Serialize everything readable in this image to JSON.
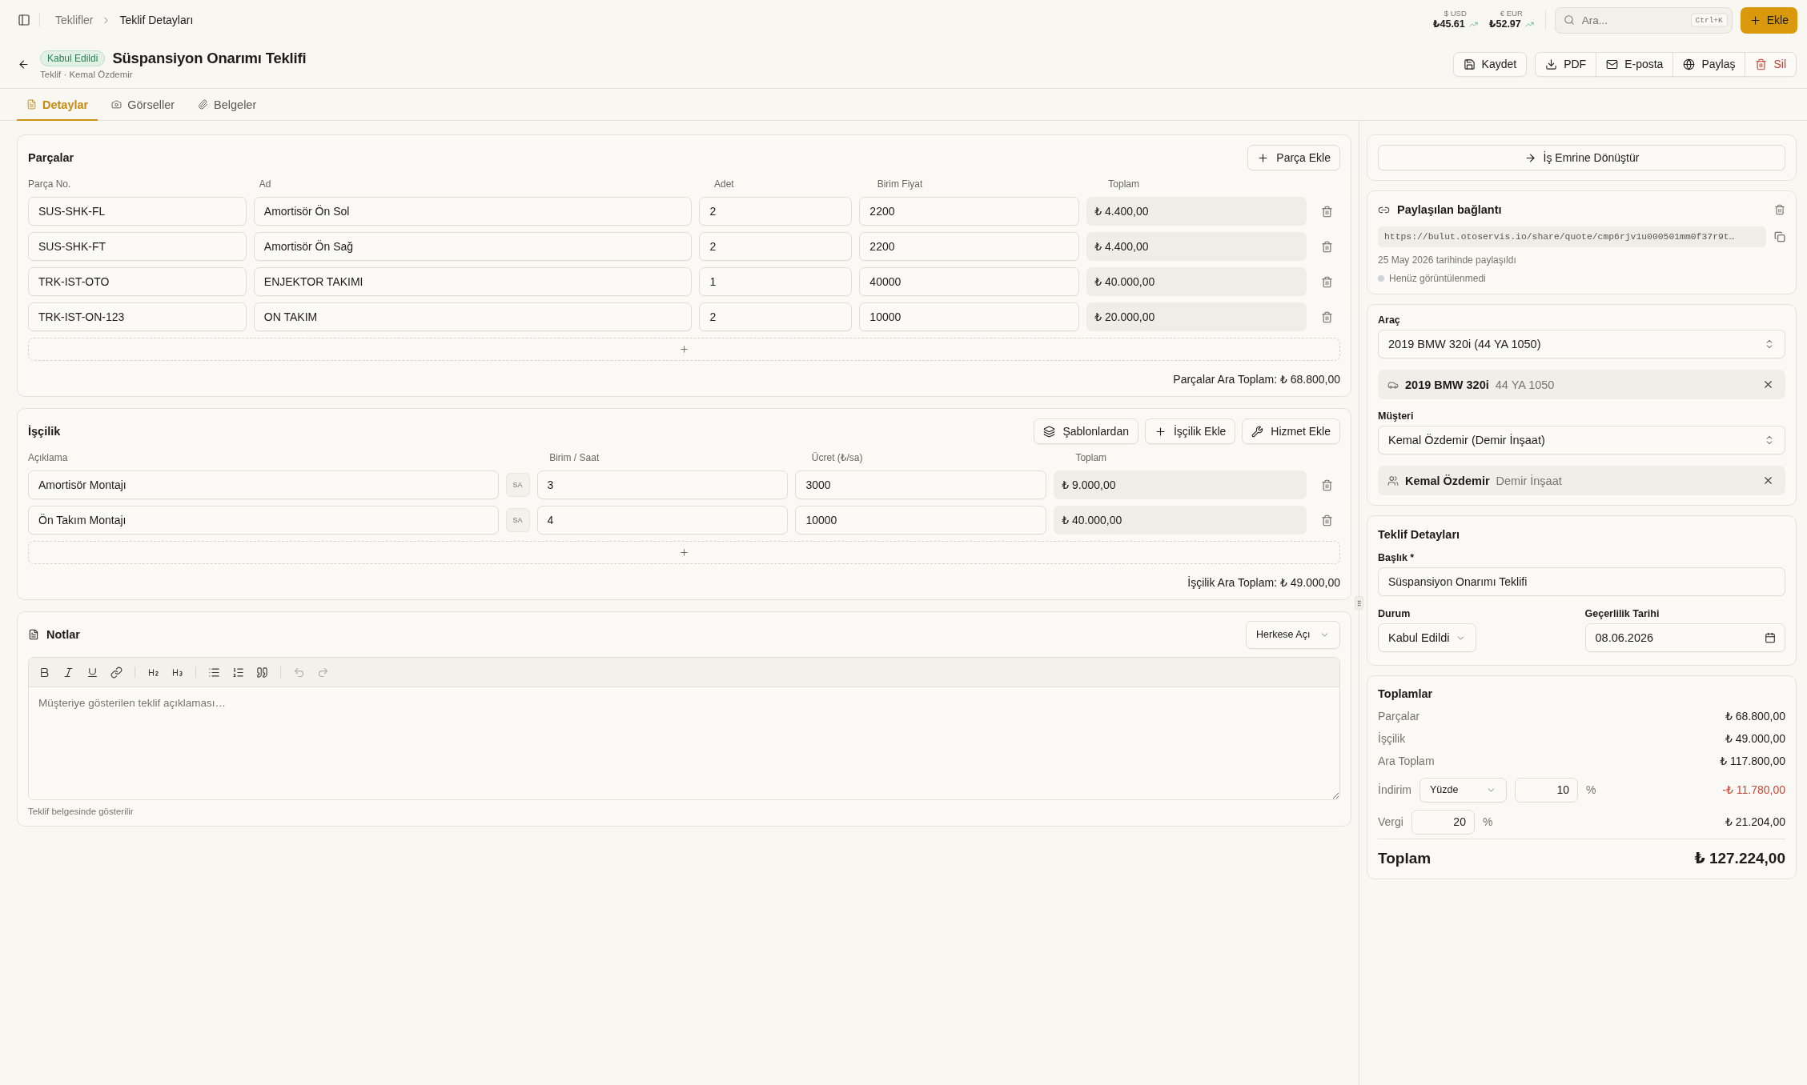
{
  "topbar": {
    "breadcrumb": {
      "parent": "Teklifler",
      "current": "Teklif Detayları"
    },
    "rates": [
      {
        "label": "$ USD",
        "value": "₺45.61"
      },
      {
        "label": "€ EUR",
        "value": "₺52.97"
      }
    ],
    "search": {
      "placeholder": "Ara...",
      "shortcut": "Ctrl+K"
    },
    "add_button": "Ekle"
  },
  "header": {
    "status": "Kabul Edildi",
    "title": "Süspansiyon Onarımı Teklifi",
    "subtitle": "Teklif · Kemal Özdemir",
    "actions": [
      {
        "kind": "save",
        "label": "Kaydet"
      },
      {
        "kind": "pdf",
        "label": "PDF"
      },
      {
        "kind": "email",
        "label": "E-posta"
      },
      {
        "kind": "share",
        "label": "Paylaş"
      },
      {
        "kind": "delete",
        "label": "Sil"
      }
    ]
  },
  "tabs": [
    {
      "kind": "details",
      "label": "Detaylar",
      "selected": true
    },
    {
      "kind": "images",
      "label": "Görseller",
      "selected": false
    },
    {
      "kind": "documents",
      "label": "Belgeler",
      "selected": false
    }
  ],
  "parts": {
    "title": "Parçalar",
    "add_button": "Parça Ekle",
    "columns": [
      "Parça No.",
      "Ad",
      "Adet",
      "Birim Fiyat",
      "Toplam"
    ],
    "rows": [
      {
        "part_no": "SUS-SHK-FL",
        "name": "Amortisör Ön Sol",
        "qty": "2",
        "unit_price": "2200",
        "total": "₺ 4.400,00"
      },
      {
        "part_no": "SUS-SHK-FT",
        "name": "Amortisör Ön Sağ",
        "qty": "2",
        "unit_price": "2200",
        "total": "₺ 4.400,00"
      },
      {
        "part_no": "TRK-IST-OTO",
        "name": "ENJEKTOR TAKIMI",
        "qty": "1",
        "unit_price": "40000",
        "total": "₺ 40.000,00"
      },
      {
        "part_no": "TRK-IST-ON-123",
        "name": "ON TAKIM",
        "qty": "2",
        "unit_price": "10000",
        "total": "₺ 20.000,00"
      }
    ],
    "subtotal": "Parçalar Ara Toplam: ₺ 68.800,00"
  },
  "labor": {
    "title": "İşçilik",
    "buttons": [
      {
        "kind": "templates",
        "label": "Şablonlardan"
      },
      {
        "kind": "add",
        "label": "İşçilik Ekle"
      },
      {
        "kind": "service",
        "label": "Hizmet Ekle"
      }
    ],
    "columns": [
      "Açıklama",
      "Birim / Saat",
      "Ücret (₺/sa)",
      "Toplam"
    ],
    "rows": [
      {
        "description": "Amortisör Montajı",
        "unit": "SA",
        "hours": "3",
        "rate": "3000",
        "total": "₺ 9.000,00"
      },
      {
        "description": "Ön Takım Montajı",
        "unit": "SA",
        "hours": "4",
        "rate": "10000",
        "total": "₺ 40.000,00"
      }
    ],
    "subtotal": "İşçilik Ara Toplam: ₺ 49.000,00"
  },
  "notes": {
    "title": "Notlar",
    "visibility": "Herkese Açı",
    "undo_disabled": true,
    "redo_disabled": true,
    "placeholder": "Müşteriye gösterilen teklif açıklaması…",
    "hint": "Teklif belgesinde gösterilir"
  },
  "convert_button": "İş Emrine Dönüştür",
  "shared_link": {
    "title": "Paylaşılan bağlantı",
    "url": "https://bulut.otoservis.io/share/quote/cmp6rjv1u000501mm0f37r9t…",
    "shared_date": "25 May 2026 tarihinde paylaşıldı",
    "views": "Henüz görüntülenmedi"
  },
  "vehicle": {
    "label": "Araç",
    "select_value": "2019 BMW 320i (44 YA 1050)",
    "chip": {
      "name": "2019 BMW 320i",
      "detail": "44 YA 1050"
    }
  },
  "customer": {
    "label": "Müşteri",
    "select_value": "Kemal Özdemir (Demir İnşaat)",
    "chip": {
      "name": "Kemal Özdemir",
      "detail": "Demir İnşaat"
    }
  },
  "quote_details": {
    "title": "Teklif Detayları",
    "title_label": "Başlık *",
    "title_value": "Süspansiyon Onarımı Teklifi",
    "status_label": "Durum",
    "status_value": "Kabul Edildi",
    "valid_label": "Geçerlilik Tarihi",
    "valid_value": "08.06.2026"
  },
  "totals": {
    "title": "Toplamlar",
    "rows": [
      {
        "label": "Parçalar",
        "value": "₺ 68.800,00"
      },
      {
        "label": "İşçilik",
        "value": "₺ 49.000,00"
      },
      {
        "label": "Ara Toplam",
        "value": "₺ 117.800,00"
      }
    ],
    "discount": {
      "label": "İndirim",
      "type": "Yüzde",
      "value": "10",
      "unit": "%",
      "amount": "-₺ 11.780,00"
    },
    "tax": {
      "label": "Vergi",
      "value": "20",
      "unit": "%",
      "amount": "₺ 21.204,00"
    },
    "grand_total": {
      "label": "Toplam",
      "value": "₺ 127.224,00"
    }
  }
}
